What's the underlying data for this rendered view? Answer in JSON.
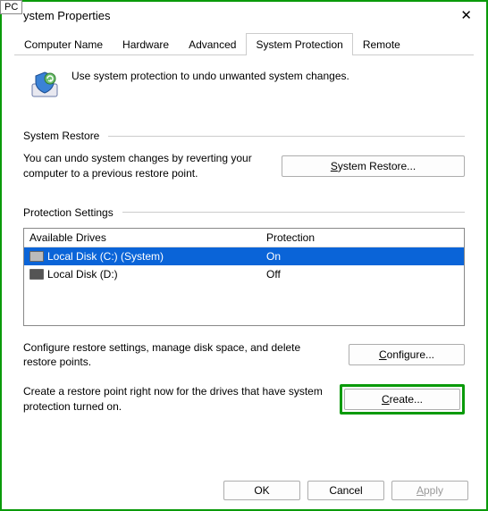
{
  "corner_tag": "PC",
  "window": {
    "title": "ystem Properties"
  },
  "tabs": [
    {
      "label": "Computer Name"
    },
    {
      "label": "Hardware"
    },
    {
      "label": "Advanced"
    },
    {
      "label": "System Protection",
      "active": true
    },
    {
      "label": "Remote"
    }
  ],
  "intro": "Use system protection to undo unwanted system changes.",
  "sections": {
    "restore": {
      "title": "System Restore",
      "text": "You can undo system changes by reverting your computer to a previous restore point.",
      "button": "System Restore..."
    },
    "protection": {
      "title": "Protection Settings",
      "headers": {
        "drives": "Available Drives",
        "protection": "Protection"
      },
      "drives": [
        {
          "name": "Local Disk (C:) (System)",
          "protection": "On",
          "selected": true
        },
        {
          "name": "Local Disk (D:)",
          "protection": "Off",
          "selected": false
        }
      ],
      "configure": {
        "text": "Configure restore settings, manage disk space, and delete restore points.",
        "button": "Configure..."
      },
      "create": {
        "text": "Create a restore point right now for the drives that have system protection turned on.",
        "button": "Create..."
      }
    }
  },
  "dialog_buttons": {
    "ok": "OK",
    "cancel": "Cancel",
    "apply": "Apply"
  }
}
